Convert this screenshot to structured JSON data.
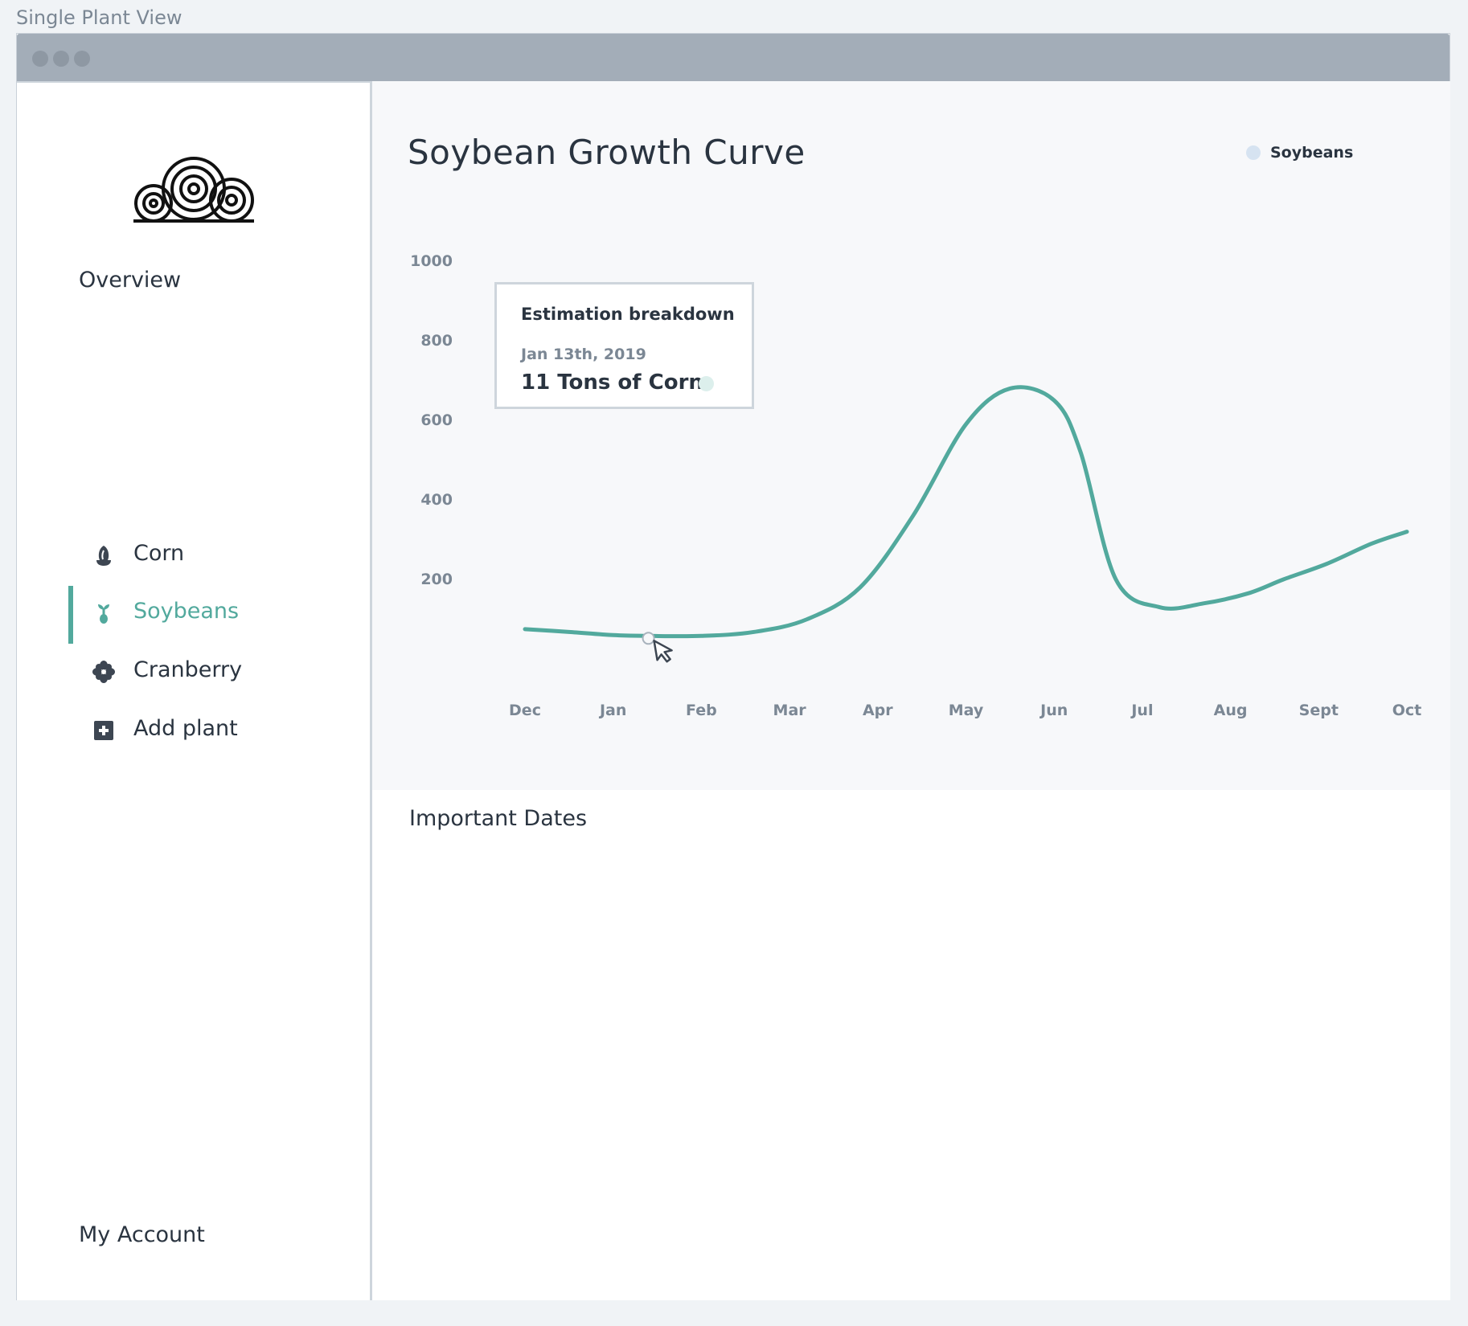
{
  "page_label": "Single Plant View",
  "sidebar": {
    "overview": "Overview",
    "items": [
      {
        "label": "Corn",
        "icon": "corn-icon",
        "active": false
      },
      {
        "label": "Soybeans",
        "icon": "soybean-sprout-icon",
        "active": true
      },
      {
        "label": "Cranberry",
        "icon": "cranberry-flower-icon",
        "active": false
      },
      {
        "label": "Add plant",
        "icon": "plus-square-icon",
        "active": false
      }
    ],
    "account": "My Account"
  },
  "chart_panel": {
    "title": "Soybean Growth Curve",
    "legend": "Soybeans",
    "tooltip": {
      "title": "Estimation breakdown",
      "date": "Jan 13th, 2019",
      "value": "11 Tons of Corn"
    }
  },
  "chart_data": {
    "type": "line",
    "title": "Soybean Growth Curve",
    "xlabel": "",
    "ylabel": "",
    "categories": [
      "Dec",
      "Jan",
      "Feb",
      "Mar",
      "Apr",
      "May",
      "Jun",
      "Jul",
      "Aug",
      "Sept",
      "Oct"
    ],
    "y_ticks": [
      "1000",
      "800",
      "600",
      "400",
      "200"
    ],
    "ylim": [
      0,
      1000
    ],
    "series": [
      {
        "name": "Soybeans",
        "color": "#52a99d",
        "x": [
          0,
          0.5,
          1.0,
          1.4,
          2.0,
          2.6,
          3.2,
          3.8,
          4.4,
          5.0,
          5.5,
          6.0,
          6.3,
          6.7,
          7.2,
          7.7,
          8.2,
          8.6,
          9.1,
          9.6,
          10.0
        ],
        "values": [
          75,
          68,
          60,
          58,
          58,
          68,
          100,
          180,
          360,
          590,
          680,
          650,
          520,
          200,
          130,
          140,
          165,
          200,
          240,
          290,
          320
        ]
      }
    ],
    "hover_point": {
      "x": 1.4,
      "y": 58,
      "label": "Jan 13th, 2019"
    },
    "grid": false,
    "legend_position": "top-right"
  },
  "dates_panel": {
    "title": "Important Dates"
  },
  "colors": {
    "accent": "#52a99d",
    "text": "#2a3440",
    "muted": "#7b8794",
    "titlebar": "#a3adb8"
  }
}
